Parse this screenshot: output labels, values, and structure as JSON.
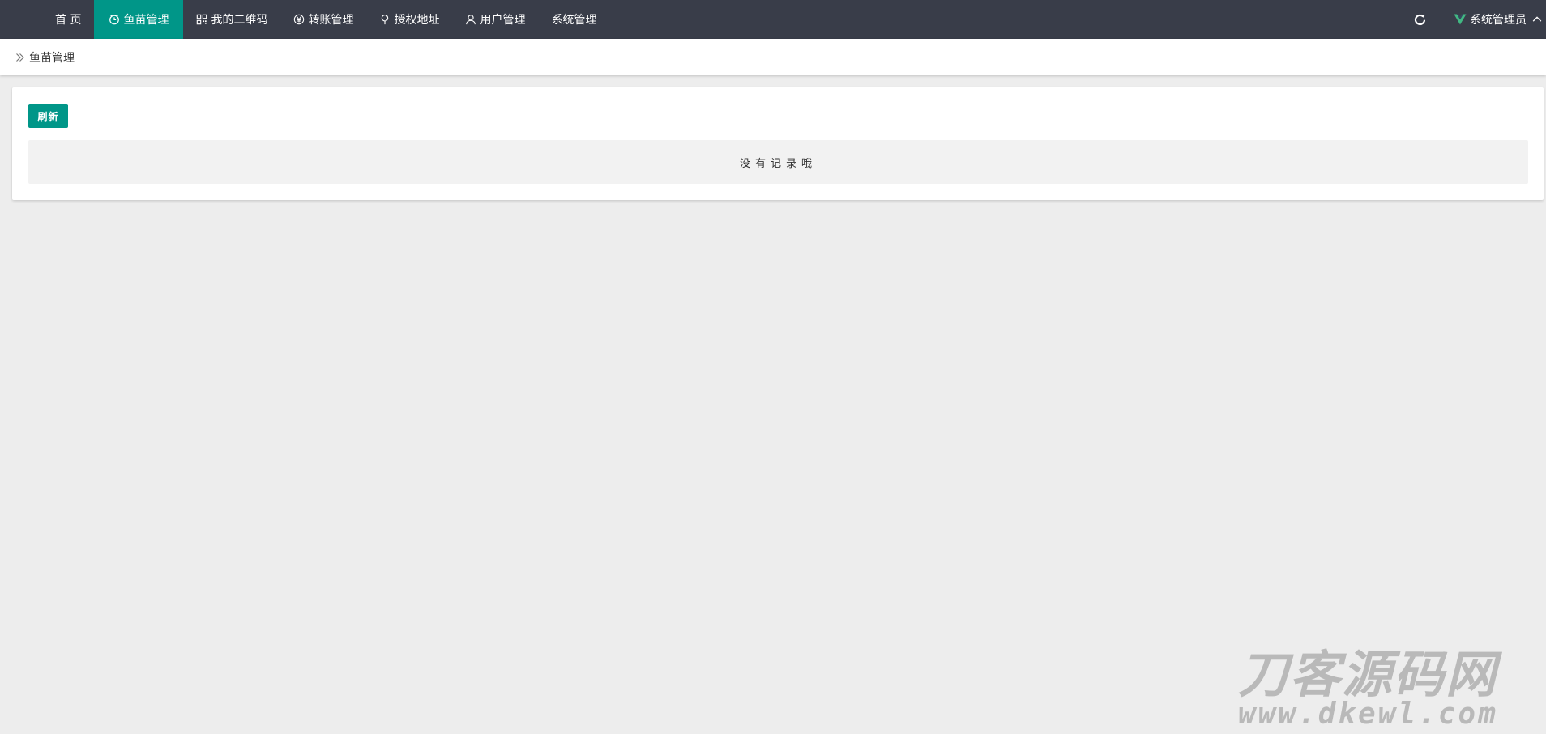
{
  "nav": {
    "items": [
      {
        "label": "首 页",
        "icon": "none",
        "active": false
      },
      {
        "label": "鱼苗管理",
        "icon": "timer-icon",
        "active": true
      },
      {
        "label": "我的二维码",
        "icon": "qrcode-icon",
        "active": false
      },
      {
        "label": "转账管理",
        "icon": "yen-icon",
        "active": false
      },
      {
        "label": "授权地址",
        "icon": "location-pin-icon",
        "active": false
      },
      {
        "label": "用户管理",
        "icon": "user-icon",
        "active": false
      },
      {
        "label": "系统管理",
        "icon": "none",
        "active": false
      }
    ]
  },
  "header": {
    "refresh_icon": "refresh-icon",
    "user_logo_icon": "v-logo-icon",
    "user_name": "系统管理员",
    "user_caret_icon": "chevron-up-icon"
  },
  "breadcrumb": {
    "icon": "double-chevron-right-icon",
    "current": "鱼苗管理"
  },
  "main": {
    "refresh_button_label": "刷新",
    "empty_text": "没有记录哦"
  },
  "watermark": {
    "text_cn": "刀客源码网",
    "text_url": "www.dkewl.com"
  },
  "colors": {
    "topbar_bg": "#393d49",
    "accent": "#009688",
    "page_bg": "#ededed",
    "card_bg": "#ffffff",
    "empty_bg": "#f2f2f2",
    "vue_green": "#41b883",
    "watermark": "#b9b9b9"
  }
}
